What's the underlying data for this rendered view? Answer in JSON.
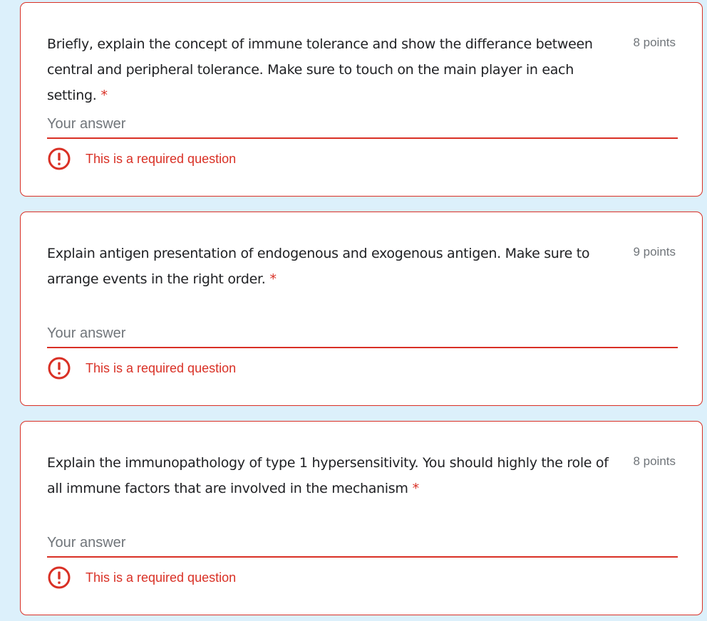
{
  "questions": [
    {
      "text": "Briefly, explain the concept of immune tolerance and show the differance between central and peripheral tolerance. Make sure to touch on the main player in each setting.",
      "required_mark": "*",
      "points": "8 points",
      "answer_placeholder": "Your answer",
      "answer_value": "",
      "error": "This is a required question"
    },
    {
      "text": "Explain antigen presentation of endogenous and exogenous antigen. Make sure to arrange events in the right order.",
      "required_mark": "*",
      "points": "9 points",
      "answer_placeholder": "Your answer",
      "answer_value": "",
      "error": "This is a required question"
    },
    {
      "text": "Explain the immunopathology of type 1 hypersensitivity. You should highly the role of all immune factors that are involved in the mechanism",
      "required_mark": "*",
      "points": "8 points",
      "answer_placeholder": "Your answer",
      "answer_value": "",
      "error": "This is a required question"
    }
  ],
  "icons": {
    "error": "alert-circle-icon"
  },
  "colors": {
    "background": "#dcf0fb",
    "error_red": "#d93025",
    "text": "#202124",
    "muted": "#70757a"
  }
}
